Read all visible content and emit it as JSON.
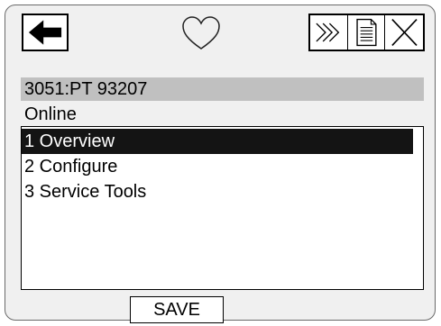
{
  "toolbar": {
    "back_icon": "back-arrow-icon",
    "favorite_icon": "heart-outline-icon",
    "more_icon": "triple-chevron-right-icon",
    "document_icon": "document-icon",
    "close_icon": "close-x-icon"
  },
  "device": {
    "tag": "3051:PT 93207",
    "status": "Online"
  },
  "menu": {
    "items": [
      {
        "label": "1 Overview",
        "selected": true
      },
      {
        "label": "2 Configure",
        "selected": false
      },
      {
        "label": "3 Service Tools",
        "selected": false
      }
    ]
  },
  "footer": {
    "save_label": "SAVE"
  },
  "colors": {
    "header_bar": "#c0c0c0",
    "selection": "#141414",
    "frame_bg": "#f0f0f0"
  }
}
